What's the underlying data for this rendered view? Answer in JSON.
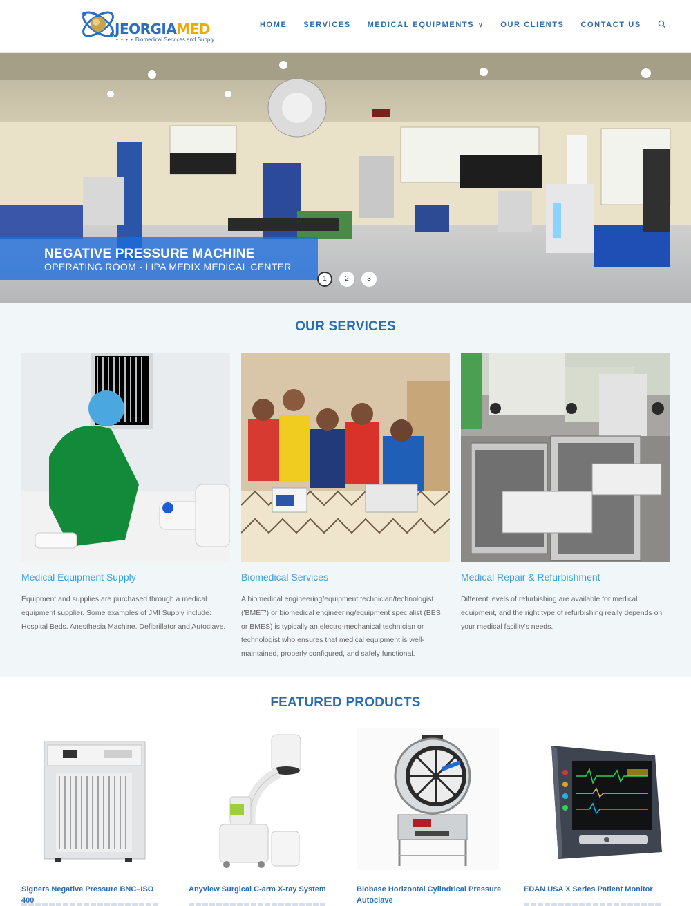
{
  "header": {
    "logo": {
      "name_a": "JEORGIA",
      "name_b": "MED",
      "dots": "• • • •",
      "tagline": "Biomedical Services and Supply"
    },
    "nav": [
      {
        "label": "HOME"
      },
      {
        "label": "SERVICES"
      },
      {
        "label": "MEDICAL EQUIPMENTS",
        "has_dropdown": true
      },
      {
        "label": "OUR CLIENTS"
      },
      {
        "label": "CONTACT US"
      }
    ],
    "search_icon": "search-icon"
  },
  "hero": {
    "title": "NEGATIVE PRESSURE MACHINE",
    "subtitle": "OPERATING ROOM - LIPA MEDIX MEDICAL CENTER",
    "pagination": [
      "1",
      "2",
      "3"
    ],
    "active_slide": 1
  },
  "services": {
    "title": "OUR SERVICES",
    "items": [
      {
        "title": "Medical Equipment Supply",
        "text": "Equipment and supplies are purchased through a medical equipment supplier. Some examples of JMI Supply include: Hospital Beds. Anesthesia Machine. Defibrillator  and Autoclave."
      },
      {
        "title": "Biomedical Services",
        "text": "A biomedical engineering/equipment technician/technologist ('BMET') or biomedical engineering/equipment specialist (BES or BMES) is typically an electro-mechanical technician or technologist who ensures that medical equipment is well-maintained, properly configured, and safely functional."
      },
      {
        "title": "Medical Repair & Refurbishment",
        "text": "Different levels of refurbishing are available for medical equipment, and the right type of refurbishing really depends on your medical facility's needs."
      }
    ]
  },
  "products": {
    "title": "FEATURED PRODUCTS",
    "items": [
      {
        "title": "Signers Negative Pressure BNC–ISO 400"
      },
      {
        "title": "Anyview Surgical C-arm X-ray System"
      },
      {
        "title": "Biobase Horizontal Cylindrical Pressure Autoclave"
      },
      {
        "title": "EDAN USA X Series Patient Monitor"
      }
    ]
  },
  "colors": {
    "brand_blue": "#2b6cb0",
    "accent_light_blue": "#3aa0dc",
    "logo_orange": "#f0a800",
    "section_bg": "#f1f6f8"
  }
}
